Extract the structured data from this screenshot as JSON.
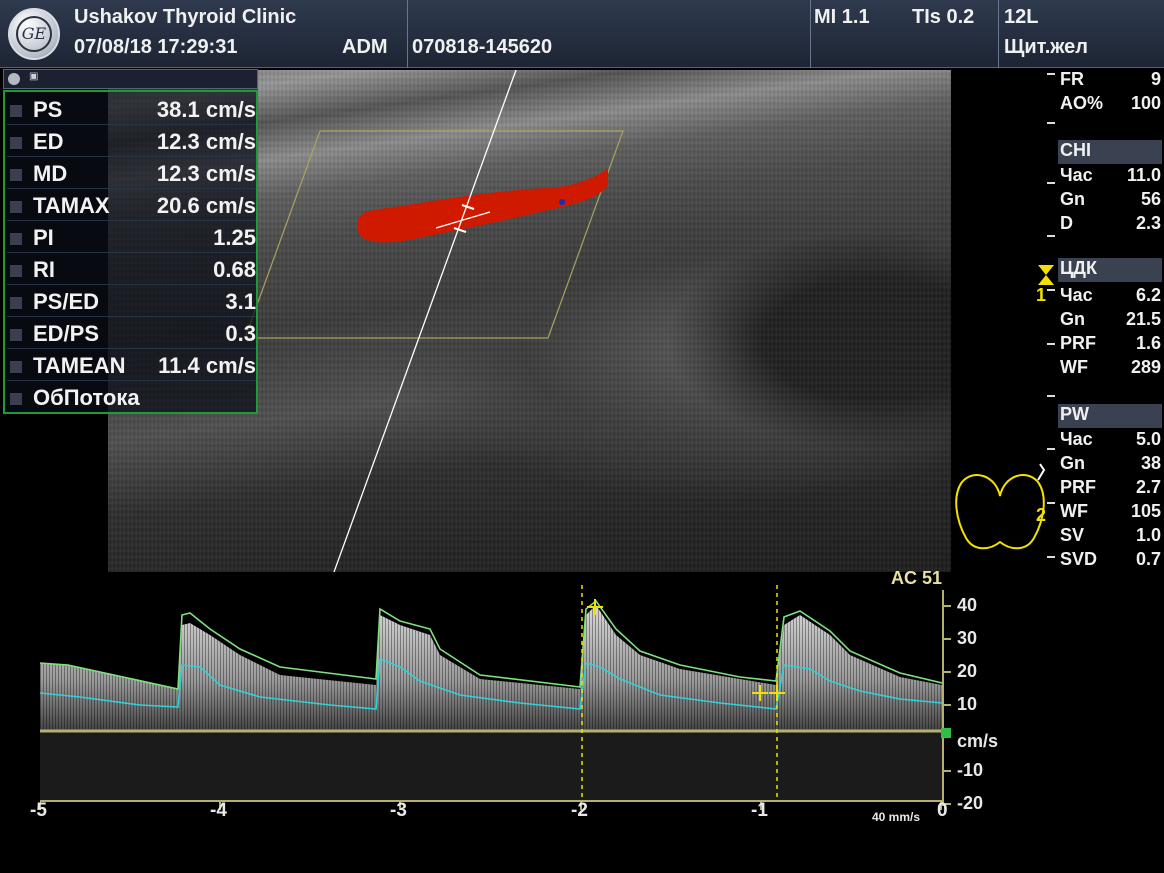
{
  "header": {
    "clinic": "Ushakov Thyroid Clinic",
    "datetime": "07/08/18 17:29:31",
    "operator": "ADM",
    "exam_id": "070818-145620",
    "mi": "MI 1.1",
    "tis": "TIs 0.2",
    "probe": "12L",
    "preset": "Щит.жел",
    "logo_text": "GE"
  },
  "measurements": {
    "header_icon": "measure-icon",
    "rows": [
      {
        "label": "PS",
        "value": "38.1 cm/s"
      },
      {
        "label": "ED",
        "value": "12.3 cm/s"
      },
      {
        "label": "MD",
        "value": "12.3 cm/s"
      },
      {
        "label": "TAMAX",
        "value": "20.6 cm/s"
      },
      {
        "label": "PI",
        "value": "1.25"
      },
      {
        "label": "RI",
        "value": "0.68"
      },
      {
        "label": "PS/ED",
        "value": "3.1"
      },
      {
        "label": "ED/PS",
        "value": "0.3"
      },
      {
        "label": "TAMEAN",
        "value": "11.4 cm/s"
      },
      {
        "label": "ОбПотока",
        "value": ""
      }
    ]
  },
  "params": {
    "top": [
      {
        "label": "FR",
        "value": "9"
      },
      {
        "label": "AO%",
        "value": "100"
      }
    ],
    "chi": {
      "title": "CHI",
      "rows": [
        {
          "label": "Час",
          "value": "11.0"
        },
        {
          "label": "Gn",
          "value": "56"
        },
        {
          "label": "D",
          "value": "2.3"
        }
      ]
    },
    "cdk": {
      "title": "ЦДК",
      "rows": [
        {
          "label": "Час",
          "value": "6.2"
        },
        {
          "label": "Gn",
          "value": "21.5"
        },
        {
          "label": "PRF",
          "value": "1.6"
        },
        {
          "label": "WF",
          "value": "289"
        }
      ]
    },
    "pw": {
      "title": "PW",
      "rows": [
        {
          "label": "Час",
          "value": "5.0"
        },
        {
          "label": "Gn",
          "value": "38"
        },
        {
          "label": "PRF",
          "value": "2.7"
        },
        {
          "label": "WF",
          "value": "105"
        },
        {
          "label": "SV",
          "value": "1.0"
        },
        {
          "label": "SVD",
          "value": "0.7"
        }
      ]
    },
    "marker1": "1",
    "marker2": "2"
  },
  "spectral": {
    "ac_label": "AC 51",
    "y_ticks": [
      "40",
      "30",
      "20",
      "10",
      "cm/s",
      "-10",
      "-20"
    ],
    "x_ticks": [
      "-5",
      "-4",
      "-3",
      "-2",
      "-1",
      "0"
    ],
    "sweep_speed": "40 mm/s"
  },
  "colors": {
    "header_bg": "#2a3344",
    "meas_border": "#1f9a3a",
    "doppler_red": "#d01a00",
    "envelope_max": "#7ee07e",
    "envelope_mean": "#2fd0d8",
    "baseline": "#b5b070",
    "cursor_yellow": "#f2e100"
  }
}
